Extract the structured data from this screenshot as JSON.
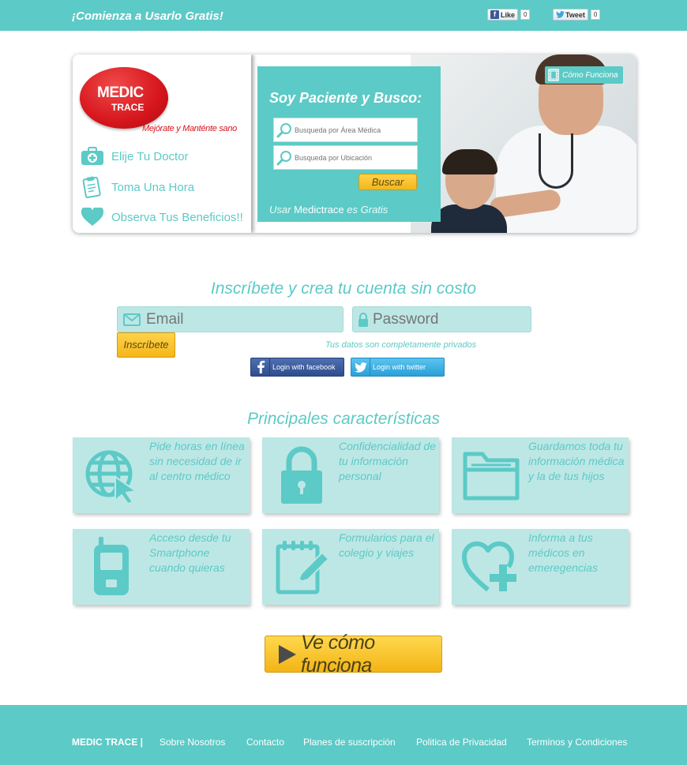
{
  "topbar": {
    "slogan": "¡Comienza a Usarlo Gratis!",
    "like_label": "Like",
    "like_count": "0",
    "tweet_label": "Tweet",
    "tweet_count": "0"
  },
  "brand": {
    "logo_line1": "MEDIC",
    "logo_line2": "TRACE",
    "tagline": "Mejórate y Manténte sano"
  },
  "hero": {
    "features": [
      {
        "label": "Elije Tu Doctor",
        "icon": "medical-kit-icon"
      },
      {
        "label": "Toma Una Hora",
        "icon": "clipboard-icon"
      },
      {
        "label": "Observa Tus Beneficios!!",
        "icon": "heart-icon"
      }
    ],
    "search_title": "Soy Paciente y Busco:",
    "search_area_placeholder": "Busqueda por Área Médica",
    "search_location_placeholder": "Busqueda por Ubicación",
    "search_button": "Buscar",
    "usar_prefix": "Usar",
    "usar_brand": "Medictrace",
    "usar_suffix": "es Gratis",
    "como_funciona": "Cómo Funciona"
  },
  "signup": {
    "heading": "Inscríbete y crea tu cuenta sin costo",
    "email_placeholder": "Email",
    "password_placeholder": "Password",
    "submit_label": "Inscríbete",
    "privacy_note": "Tus datos son completamente privados",
    "facebook_label": "Login with facebook",
    "twitter_label": "Login with twitter"
  },
  "features": {
    "heading": "Principales características",
    "cards": [
      {
        "text": "Pide horas en línea sin necesidad de ir al centro médico",
        "icon": "globe-cursor-icon"
      },
      {
        "text": "Confidencialidad de tu información personal",
        "icon": "padlock-icon"
      },
      {
        "text": "Guardamos toda tu información médica y la de tus hijos",
        "icon": "folder-icon"
      },
      {
        "text": "Acceso desde tu Smartphone cuando quieras",
        "icon": "cellphone-icon"
      },
      {
        "text": "Formularios para el colegio y viajes",
        "icon": "notepad-pencil-icon"
      },
      {
        "text": "Informa a tus médicos en emeregencias",
        "icon": "heart-plus-icon"
      }
    ]
  },
  "cta": {
    "label": "Ve cómo funciona"
  },
  "footer": {
    "brand": "MEDIC TRACE  |",
    "links": [
      "Sobre Nosotros",
      "Contacto",
      "Planes de suscripción",
      "Politica de Privacidad",
      "Terminos y Condiciones"
    ]
  },
  "colors": {
    "accent": "#5ccac6",
    "card_bg": "#bde7e5",
    "button_yellow": "#f4b61a",
    "logo_red": "#d6161c"
  }
}
